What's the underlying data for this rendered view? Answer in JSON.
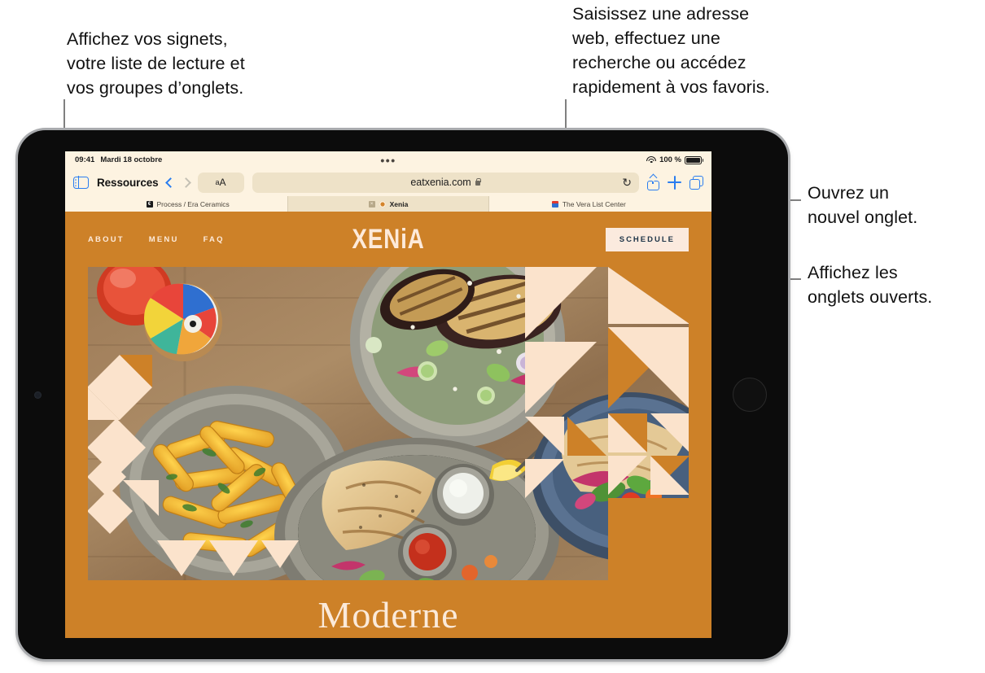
{
  "callouts": {
    "bookmarks": "Affichez vos signets,\nvotre liste de lecture et\nvos groupes d’onglets.",
    "address": "Saisissez une adresse\nweb, effectuez une\nrecherche ou accédez\nrapidement à vos favoris.",
    "new_tab": "Ouvrez un\nnouvel onglet.",
    "show_tabs": "Affichez les\nonglets ouverts."
  },
  "status_bar": {
    "time": "09:41",
    "date": "Mardi 18 octobre",
    "battery_percent": "100 %",
    "wifi_icon": "wifi-icon",
    "battery_icon": "battery-icon",
    "multitask_handle": "•••"
  },
  "toolbar": {
    "sidebar_icon": "sidebar-icon",
    "title": "Ressources",
    "back_icon": "chevron-left-icon",
    "forward_icon": "chevron-right-icon",
    "text_size_label_small": "a",
    "text_size_label_large": "A",
    "url": "eatxenia.com",
    "lock_icon": "lock-icon",
    "reload_icon": "↻",
    "share_icon": "share-icon",
    "new_tab_icon": "plus-icon",
    "tabs_overview_icon": "tabs-overview-icon"
  },
  "tabs": [
    {
      "title": "Process / Era Ceramics",
      "favicon": "process-favicon",
      "favicon_glyph": "€",
      "active": false
    },
    {
      "title": "Xenia",
      "favicon": "xenia-favicon",
      "favicon_glyph": "",
      "active": true
    },
    {
      "title": "The Vera List Center",
      "favicon": "vera-favicon",
      "favicon_glyph": "",
      "active": false
    }
  ],
  "site": {
    "nav": [
      "ABOUT",
      "MENU",
      "FAQ"
    ],
    "brand": "XENiA",
    "schedule_button": "SCHEDULE",
    "headline": "Moderne"
  },
  "colors": {
    "brand_orange": "#cd8128",
    "cream": "#fbeada",
    "toolbar_bg": "#fdf3e1",
    "pill_bg": "#eee2c8",
    "accent_blue": "#2a7df0",
    "leader_gray": "#808080"
  }
}
